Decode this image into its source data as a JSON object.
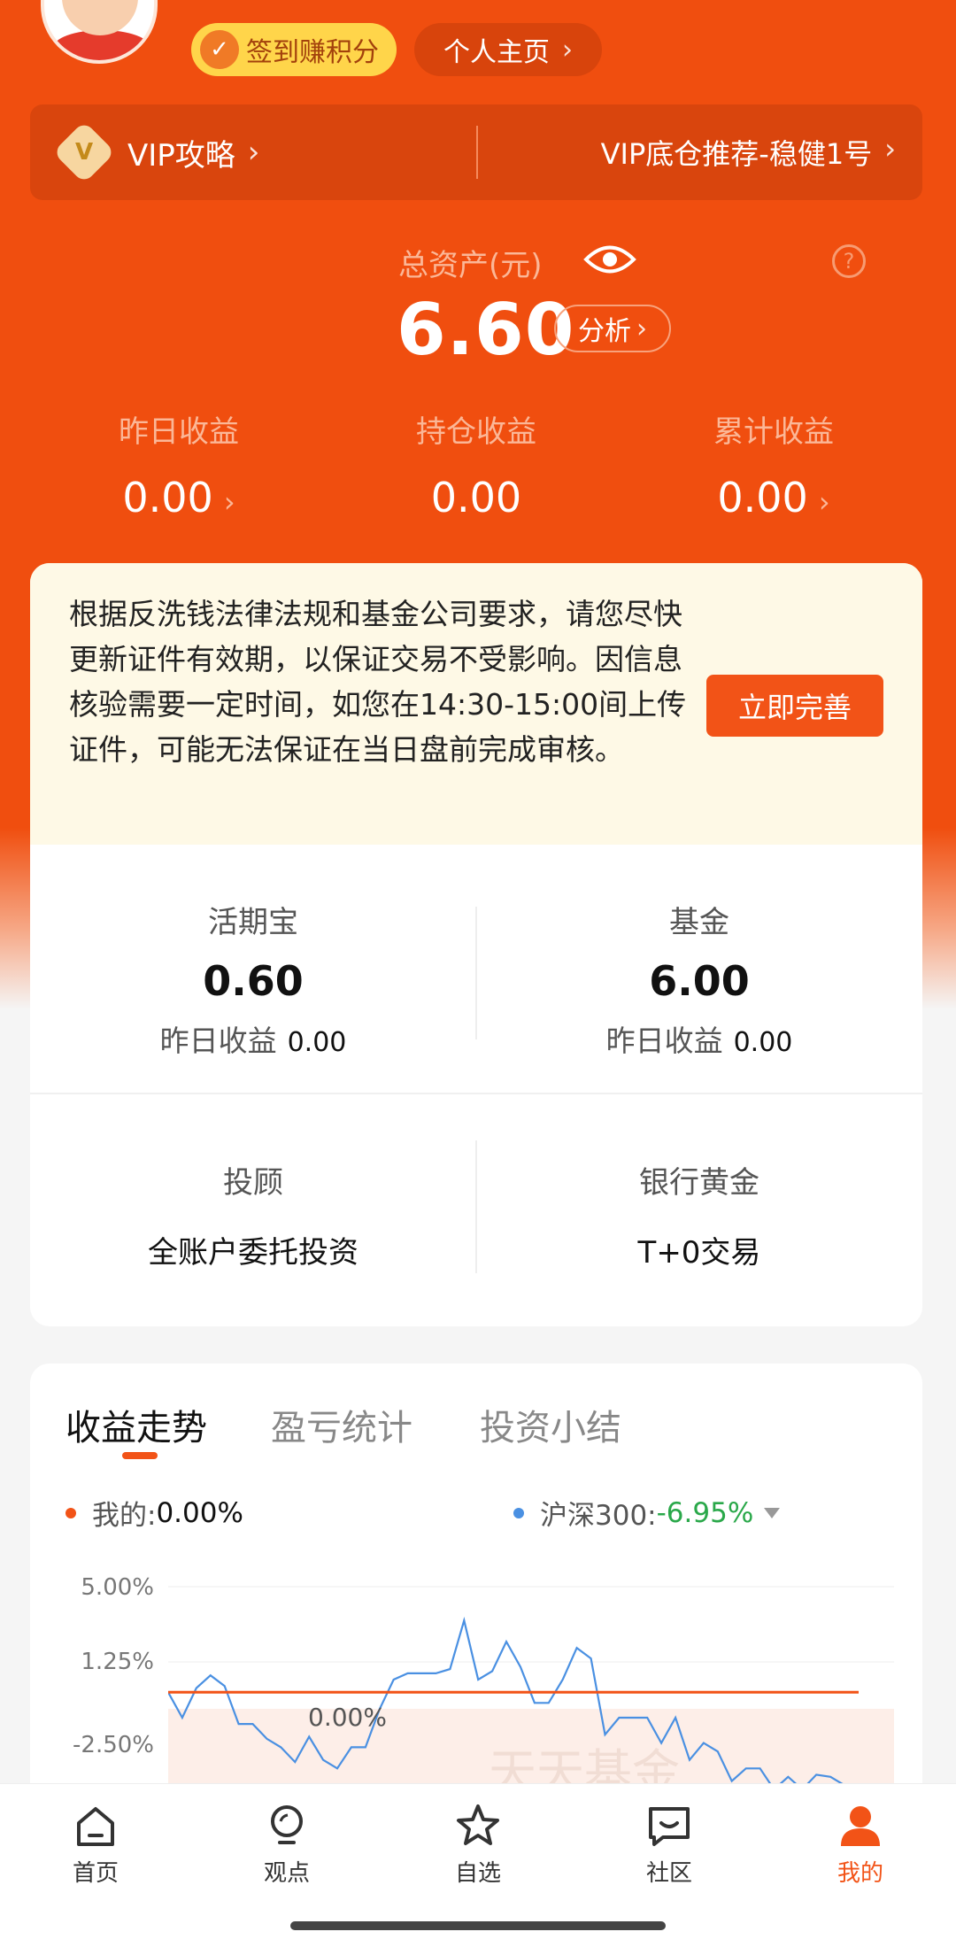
{
  "header": {
    "checkin_label": "签到赚积分",
    "profile_label": "个人主页",
    "vip_guide": "VIP攻略",
    "vip_recommend": "VIP底仓推荐-稳健1号"
  },
  "assets": {
    "total_label": "总资产(元)",
    "total_value": "6.60",
    "analyze_label": "分析",
    "yesterday_label": "昨日收益",
    "yesterday_value": "0.00",
    "holding_label": "持仓收益",
    "holding_value": "0.00",
    "cumulative_label": "累计收益",
    "cumulative_value": "0.00"
  },
  "notice": {
    "text": "根据反洗钱法律法规和基金公司要求，请您尽快更新证件有效期，以保证交易不受影响。因信息核验需要一定时间，如您在14:30-15:00间上传证件，可能无法保证在当日盘前完成审核。",
    "button": "立即完善"
  },
  "products": [
    {
      "name": "活期宝",
      "amount": "0.60",
      "sub_label": "昨日收益",
      "sub_value": "0.00"
    },
    {
      "name": "基金",
      "amount": "6.00",
      "sub_label": "昨日收益",
      "sub_value": "0.00"
    },
    {
      "name": "投顾",
      "desc": "全账户委托投资"
    },
    {
      "name": "银行黄金",
      "desc": "T+0交易"
    }
  ],
  "chart_section": {
    "tabs": [
      "收益走势",
      "盈亏统计",
      "投资小结"
    ],
    "mine_label": "我的:",
    "mine_value": "0.00%",
    "index_label": "沪深300:",
    "index_value": "-6.95%",
    "zero_label": "0.00%",
    "watermark": "天天基金",
    "colors": {
      "mine": "#f25317",
      "index": "#4a90e2",
      "negative": "#2aa84a"
    }
  },
  "chart_data": {
    "type": "line",
    "yticks": [
      "5.00%",
      "1.25%",
      "-2.50%"
    ],
    "ylim": [
      -5.0,
      5.0
    ],
    "series": [
      {
        "name": "我的",
        "values": [
          0,
          0,
          0,
          0,
          0,
          0,
          0,
          0,
          0,
          0,
          0,
          0,
          0,
          0,
          0,
          0,
          0,
          0,
          0,
          0,
          0,
          0,
          0,
          0,
          0,
          0,
          0,
          0,
          0,
          0,
          0,
          0,
          0,
          0,
          0,
          0,
          0,
          0,
          0,
          0,
          0,
          0,
          0,
          0,
          0,
          0,
          0,
          0,
          0,
          0
        ]
      },
      {
        "name": "沪深300",
        "values": [
          0,
          -1.2,
          0.2,
          0.8,
          0.3,
          -1.5,
          -1.5,
          -2.2,
          -2.6,
          -3.3,
          -2.1,
          -3.2,
          -3.6,
          -2.6,
          -2.6,
          -0.8,
          0.6,
          0.9,
          0.9,
          0.9,
          1.1,
          3.4,
          0.6,
          1.0,
          2.4,
          1.2,
          -0.5,
          -0.5,
          0.6,
          2.1,
          1.6,
          -2.0,
          -1.2,
          -1.2,
          -1.2,
          -2.4,
          -1.2,
          -3.2,
          -2.4,
          -2.8,
          -4.2,
          -3.6,
          -3.6,
          -4.6,
          -4.0,
          -4.6,
          -3.9,
          -4.0,
          -4.4,
          -4.6
        ]
      }
    ]
  },
  "nav": [
    {
      "label": "首页",
      "icon": "home-icon"
    },
    {
      "label": "观点",
      "icon": "lightbulb-icon"
    },
    {
      "label": "自选",
      "icon": "star-icon"
    },
    {
      "label": "社区",
      "icon": "chat-icon"
    },
    {
      "label": "我的",
      "icon": "user-icon"
    }
  ]
}
